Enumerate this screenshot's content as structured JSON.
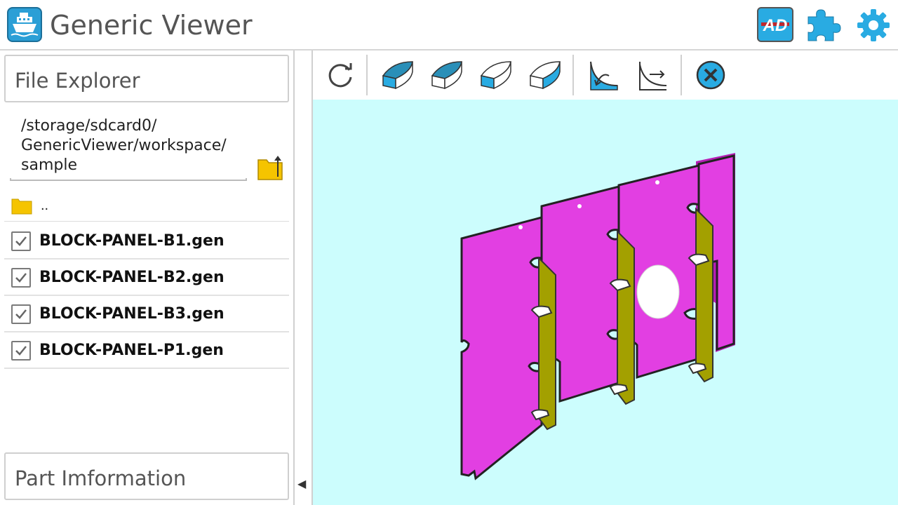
{
  "app": {
    "title": "Generic Viewer",
    "ad_label": "AD"
  },
  "explorer": {
    "header": "File Explorer",
    "path_lines": [
      "/storage/sdcard0/",
      "GenericViewer/workspace/",
      "sample"
    ],
    "parent_label": "..",
    "files": [
      {
        "name": "BLOCK-PANEL-B1.gen",
        "checked": true
      },
      {
        "name": "BLOCK-PANEL-B2.gen",
        "checked": true
      },
      {
        "name": "BLOCK-PANEL-B3.gen",
        "checked": true
      },
      {
        "name": "BLOCK-PANEL-P1.gen",
        "checked": true
      }
    ]
  },
  "part_info": {
    "header": "Part Imformation"
  },
  "toolbar": {
    "icons": [
      "rotate-icon",
      "view-top-icon",
      "view-iso-icon",
      "view-side-icon",
      "view-front-icon",
      "curve-section-icon",
      "curve-graph-icon",
      "close-icon"
    ]
  },
  "collapse": {
    "glyph": "◀"
  },
  "colors": {
    "viewport_bg": "#ccfdfd",
    "panel_magenta": "#e23fe2",
    "stiffener_olive": "#a3a000",
    "accent_blue": "#29abe2"
  }
}
